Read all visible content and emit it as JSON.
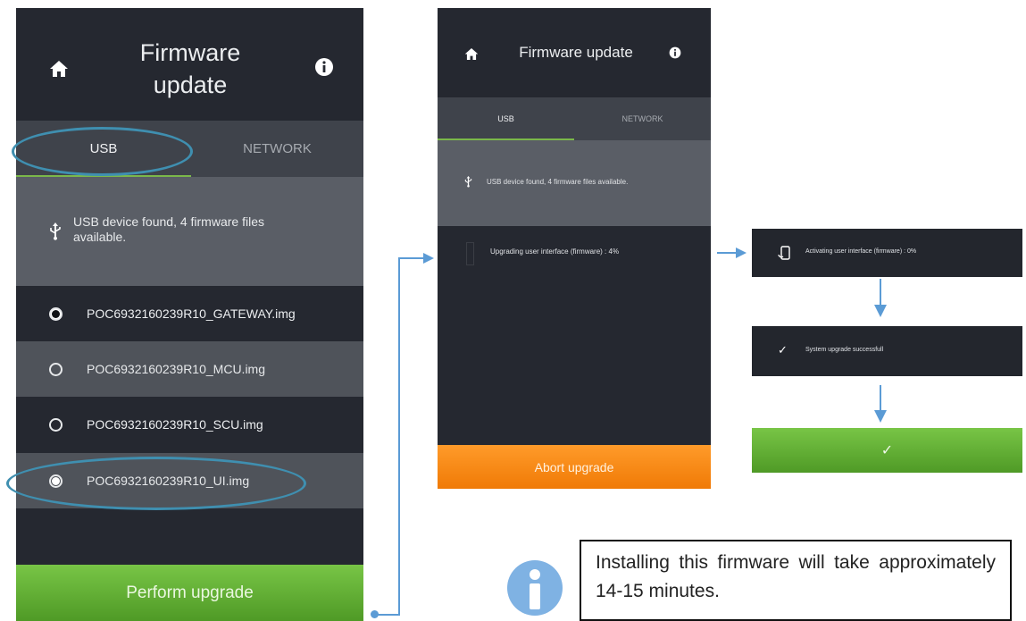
{
  "left_screen": {
    "title_line1": "Firmware",
    "title_line2": "update",
    "tabs": [
      "USB",
      "NETWORK"
    ],
    "status": "USB device found, 4 firmware files available.",
    "files": [
      {
        "name": "POC6932160239R10_GATEWAY.img",
        "radio": "filled"
      },
      {
        "name": "POC6932160239R10_MCU.img",
        "radio": "empty"
      },
      {
        "name": "POC6932160239R10_SCU.img",
        "radio": "empty"
      },
      {
        "name": "POC6932160239R10_UI.img",
        "radio": "selected"
      }
    ],
    "action_button": "Perform upgrade"
  },
  "middle_screen": {
    "title": "Firmware update",
    "tabs": [
      "USB",
      "NETWORK"
    ],
    "status": "USB device found, 4 firmware files available.",
    "progress_text": "Upgrading user interface (firmware) : 4%",
    "action_button": "Abort upgrade"
  },
  "step_cards": {
    "activating": "Activating user interface (firmware) : 0%",
    "success": "System upgrade successfull",
    "done_check": "✓"
  },
  "note": {
    "text": "Installing this firmware will take approximately 14-15 minutes.",
    "icon": "info-icon"
  },
  "colors": {
    "screen_bg": "#252830",
    "green_button": "#62b032",
    "orange_button": "#f7891a",
    "highlight_ellipse": "#3f8fb0",
    "connector": "#5b9bd5"
  }
}
